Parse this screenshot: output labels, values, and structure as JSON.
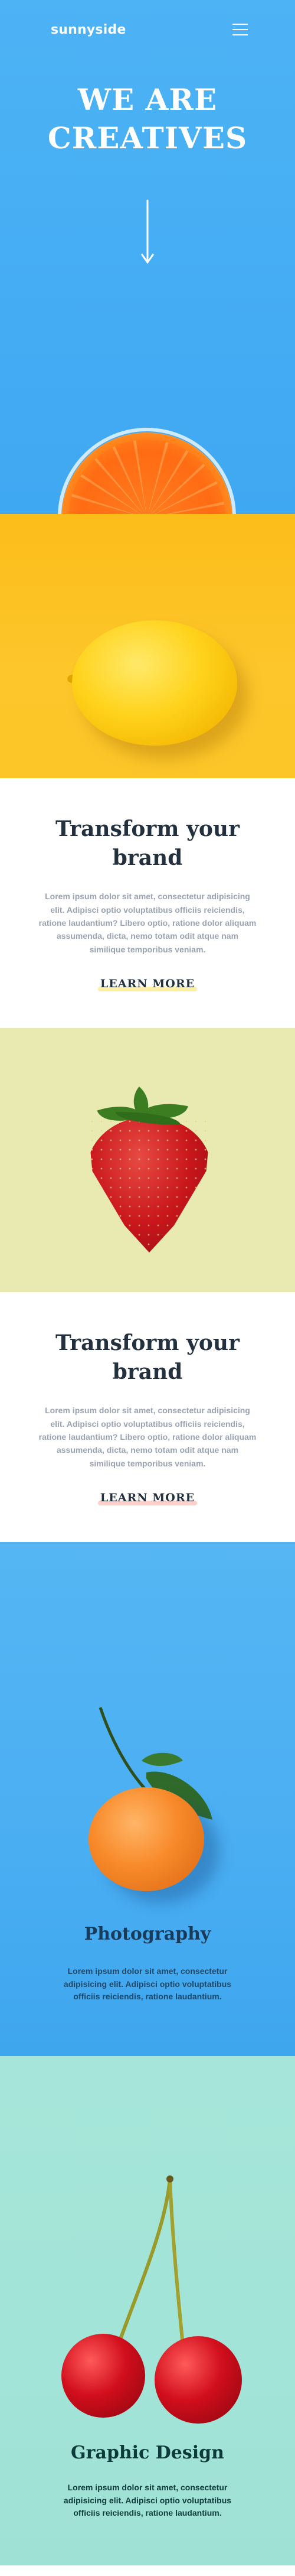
{
  "header": {
    "logo": "sunnyside",
    "menu_icon": "hamburger-menu-icon"
  },
  "hero": {
    "title_line1": "WE ARE",
    "title_line2": "CREATIVES",
    "arrow_icon": "arrow-down-icon",
    "image": "orange-in-glass"
  },
  "lemon_image": "lemon",
  "transform_1": {
    "title": "Transform your brand",
    "body": "Lorem ipsum dolor sit amet, consectetur adipisicing elit. Adipisci optio voluptatibus officiis reiciendis, ratione laudantium? Libero optio, ratione dolor aliquam assumenda, dicta, nemo totam odit atque nam similique temporibus veniam.",
    "link": "LEARN MORE",
    "underline_color": "#fad400"
  },
  "strawberry_image": "strawberry",
  "transform_2": {
    "title": "Transform your brand",
    "body": "Lorem ipsum dolor sit amet, consectetur adipisicing elit. Adipisci optio voluptatibus officiis reiciendis, ratione laudantium? Libero optio, ratione dolor aliquam assumenda, dicta, nemo totam odit atque nam similique temporibus veniam.",
    "link": "LEARN MORE",
    "underline_color": "#fe7865"
  },
  "photography": {
    "title": "Photography",
    "body": "Lorem ipsum dolor sit amet, consectetur adipisicing elit. Adipisci optio voluptatibus officiis reiciendis, ratione laudantium.",
    "image": "tangerine"
  },
  "graphic_design": {
    "title": "Graphic Design",
    "body": "Lorem ipsum dolor sit amet, consectetur adipisicing elit. Adipisci optio voluptatibus officiis reiciendis, ratione laudantium.",
    "image": "cherries"
  },
  "colors": {
    "hero_blue": "#4db3f5",
    "lemon_yellow": "#fcc21a",
    "strawberry_bg": "#e9eab2",
    "heading_dark": "#23303e",
    "body_gray": "#9aa3b2",
    "graphic_bg": "#a6e6da"
  }
}
